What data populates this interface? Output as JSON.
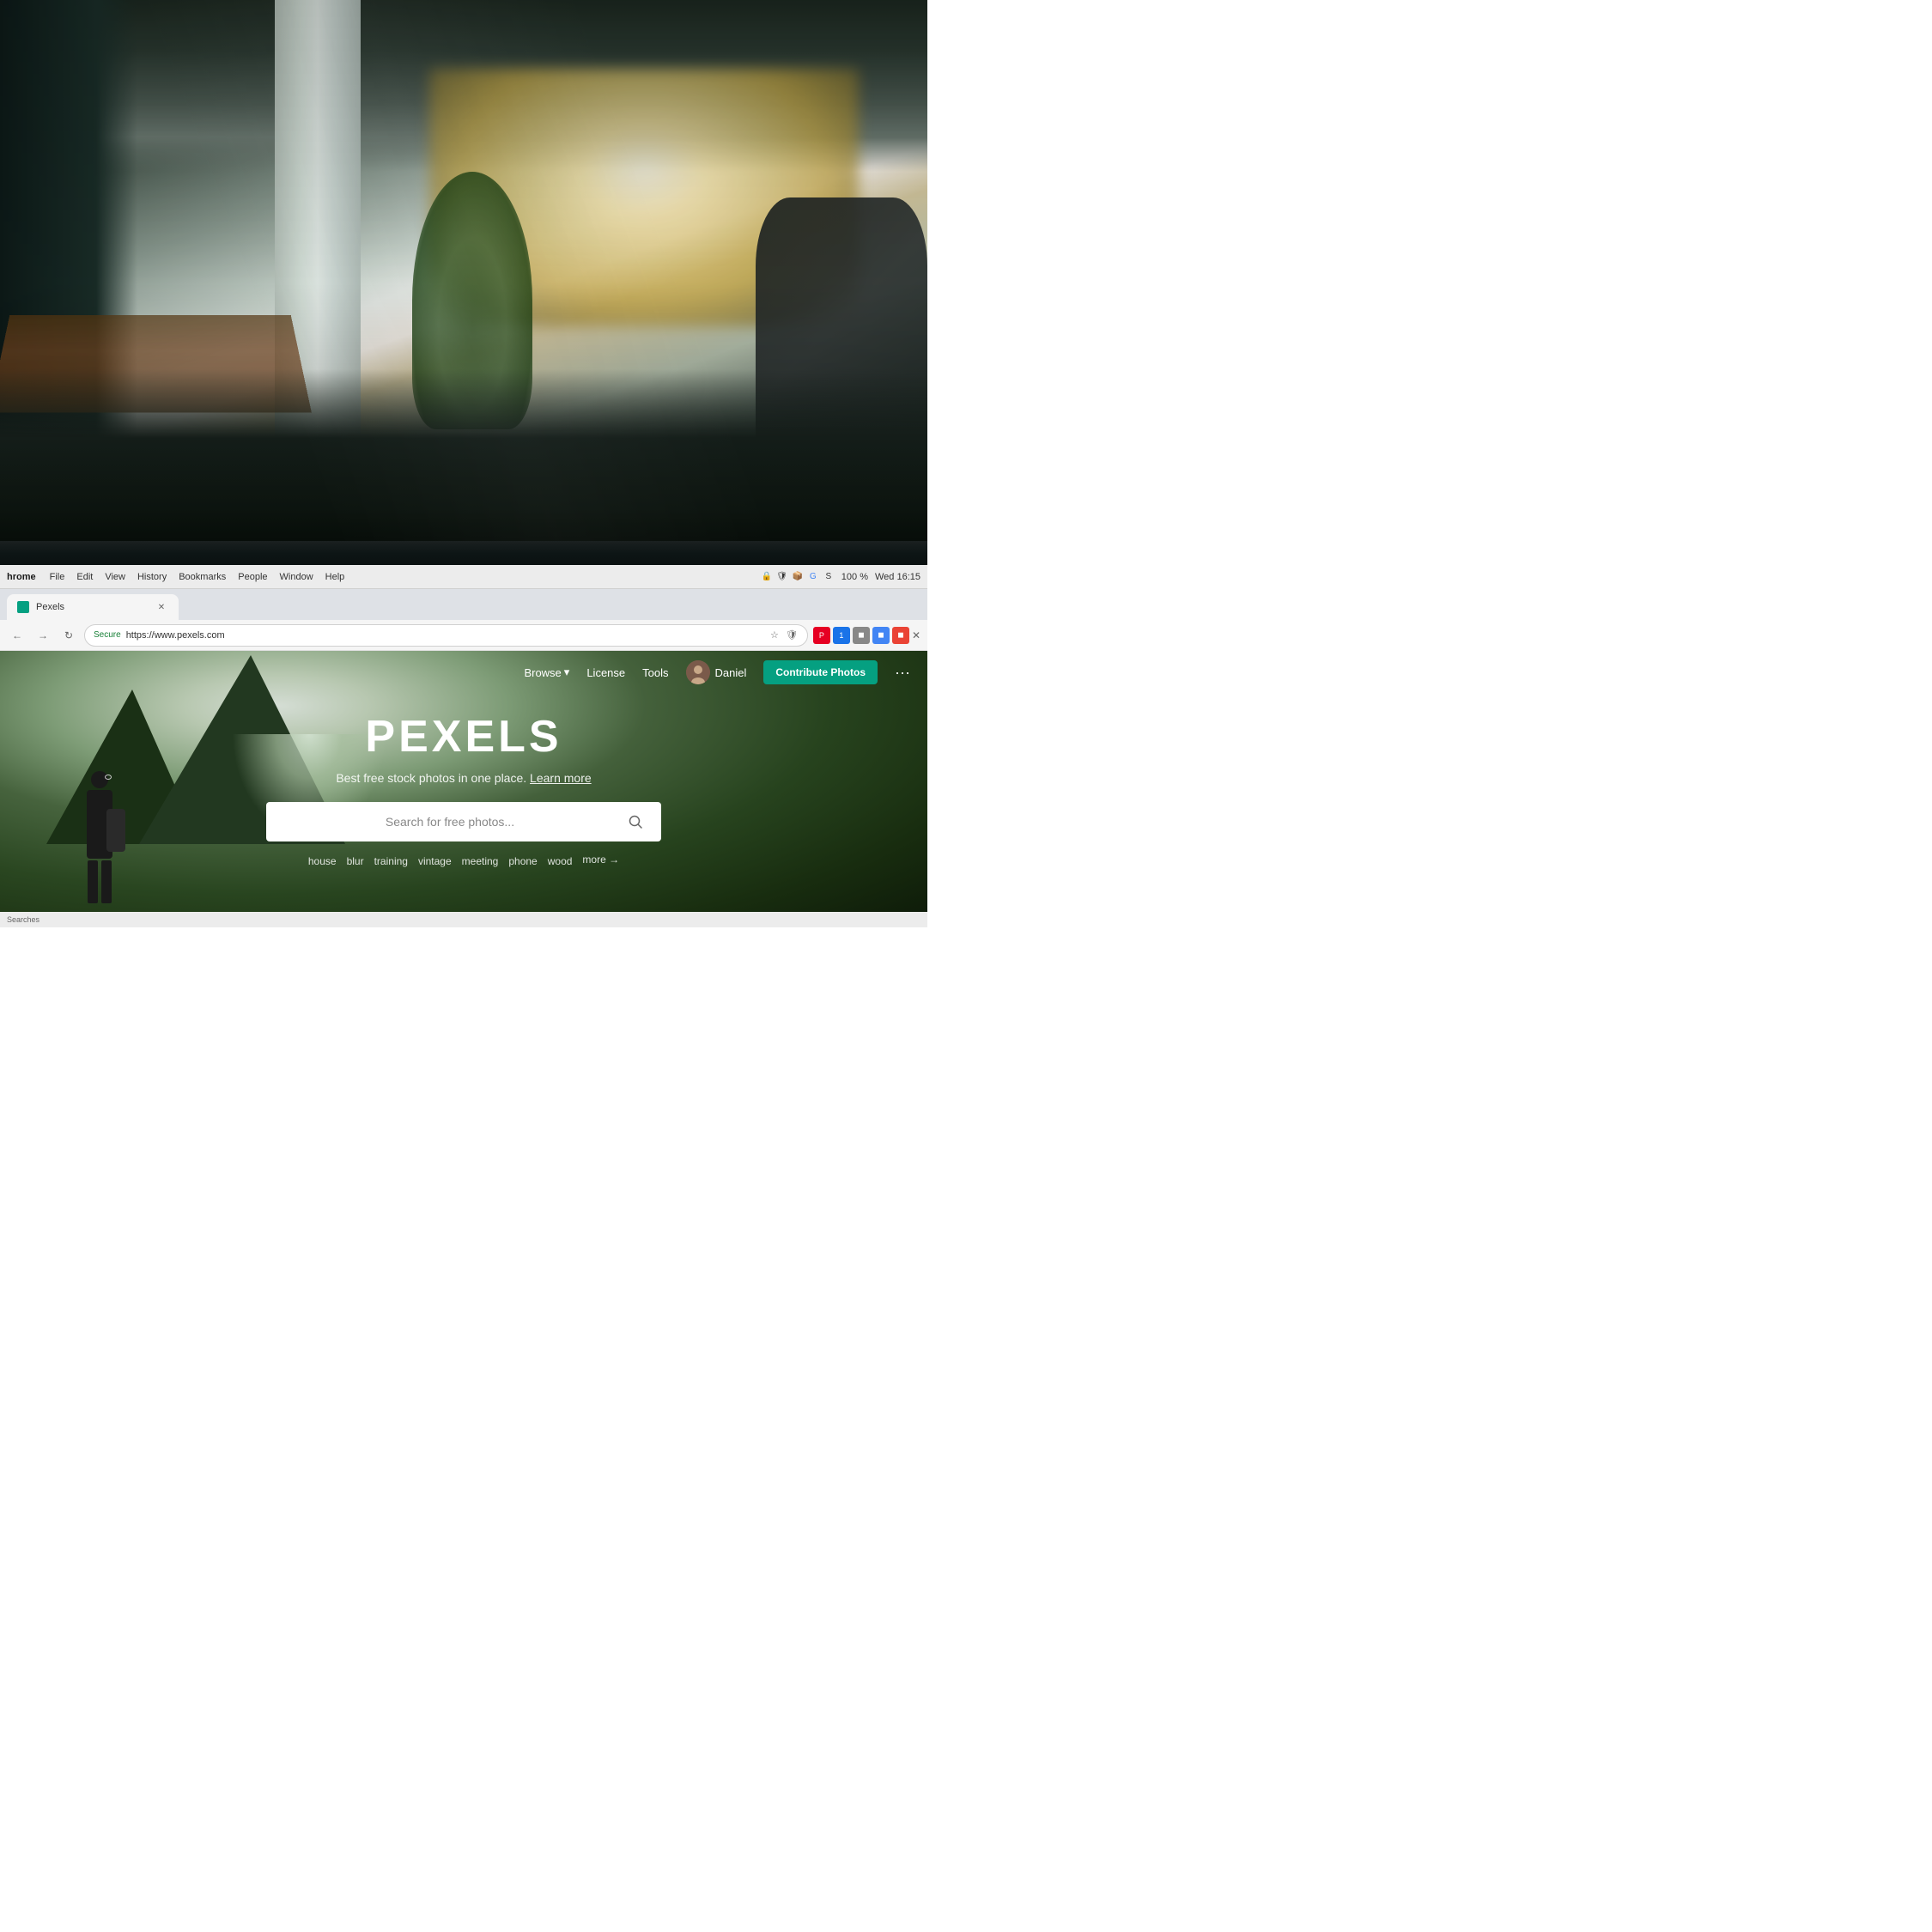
{
  "photo": {
    "description": "Office background photo"
  },
  "menu_bar": {
    "app": "hrome",
    "items": [
      "File",
      "Edit",
      "View",
      "History",
      "Bookmarks",
      "People",
      "Window",
      "Help"
    ],
    "time": "Wed 16:15",
    "battery": "100 %"
  },
  "tab": {
    "title": "Pexels",
    "favicon_color": "#05a081"
  },
  "address_bar": {
    "secure_label": "Secure",
    "url": "https://www.pexels.com",
    "back_label": "←",
    "reload_label": "↻"
  },
  "pexels": {
    "nav": {
      "browse_label": "Browse",
      "license_label": "License",
      "tools_label": "Tools",
      "user_name": "Daniel",
      "contribute_label": "Contribute Photos",
      "more_label": "···"
    },
    "hero": {
      "title": "PEXELS",
      "subtitle": "Best free stock photos in one place.",
      "subtitle_link": "Learn more",
      "search_placeholder": "Search for free photos...",
      "tags": [
        "house",
        "blur",
        "training",
        "vintage",
        "meeting",
        "phone",
        "wood"
      ],
      "more_label": "more →"
    }
  },
  "status_bar": {
    "text": "Searches"
  },
  "colors": {
    "contribute_bg": "#05a081",
    "contribute_text": "#ffffff"
  }
}
